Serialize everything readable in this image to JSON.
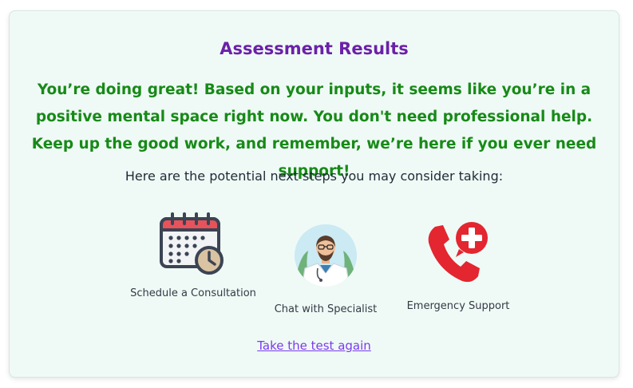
{
  "results": {
    "title": "Assessment Results",
    "message": "You’re doing great! Based on your inputs, it seems like you’re in a positive mental space right now. You don't need professional help. Keep up the good work, and remember, we’re here if you ever need support!",
    "next_steps_heading": "Here are the potential next steps you may consider taking:",
    "options": [
      {
        "label": "Schedule a Consultation",
        "icon": "calendar-clock-icon"
      },
      {
        "label": "Chat with Specialist",
        "icon": "doctor-avatar-icon"
      },
      {
        "label": "Emergency Support",
        "icon": "emergency-phone-icon"
      }
    ],
    "retake_link": "Take the test again"
  },
  "colors": {
    "card_background": "#effaf6",
    "title": "#6b21a8",
    "message": "#178a17",
    "link": "#7c3aed"
  }
}
